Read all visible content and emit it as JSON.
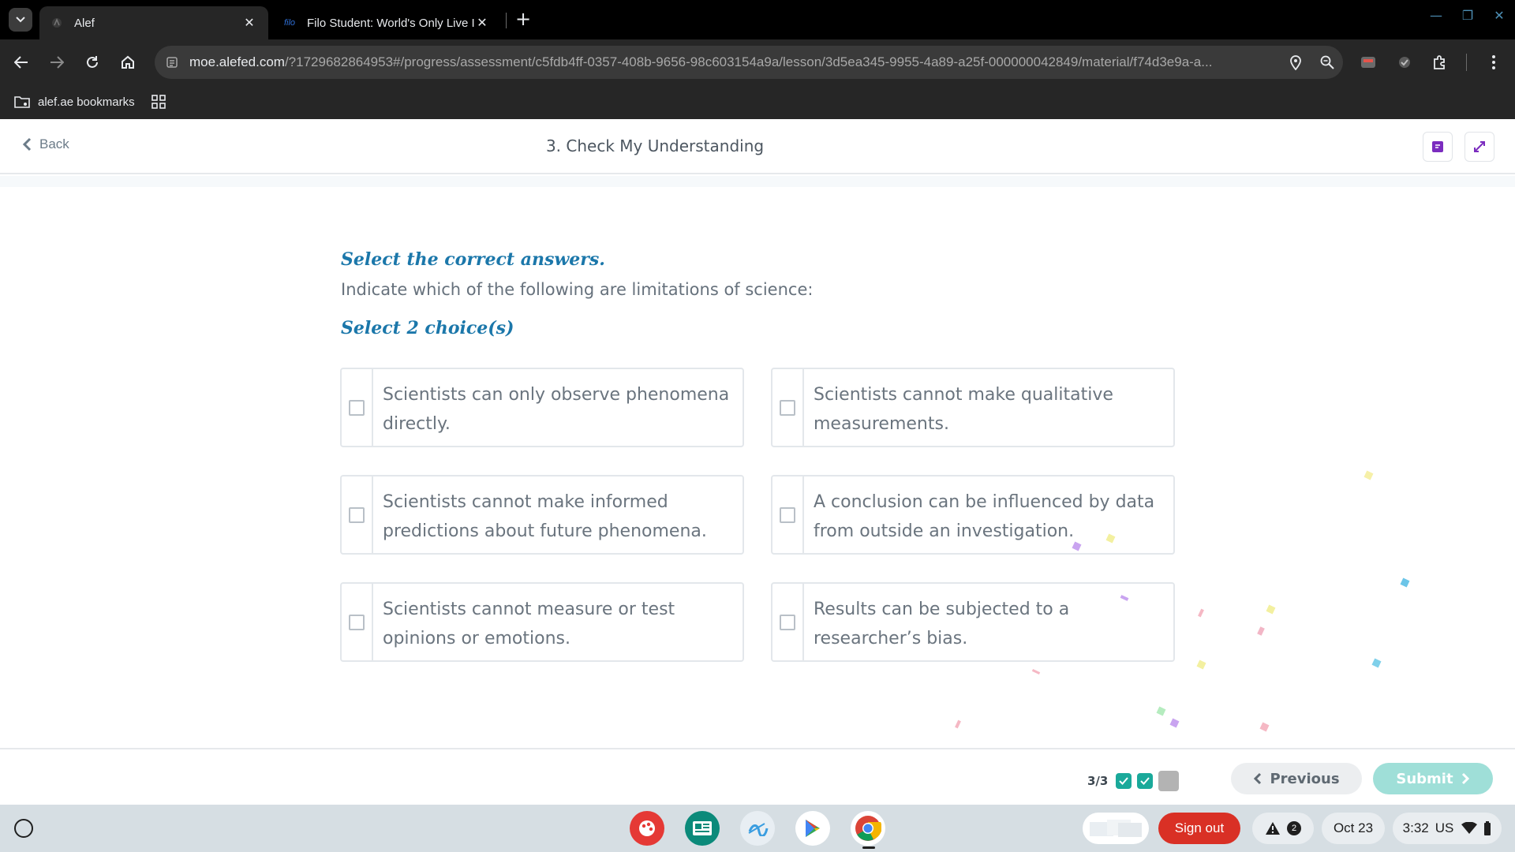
{
  "browser": {
    "tabs": [
      {
        "title": "Alef",
        "favicon": "alef-icon",
        "active": true
      },
      {
        "title": "Filo Student: World's Only Live I",
        "favicon_text": "filo",
        "active": false
      }
    ],
    "url": {
      "host": "moe.alefed.com",
      "path": "/?1729682864953#/progress/assessment/c5fdb4ff-0357-408b-9656-98c603154a9a/lesson/3d5ea345-9955-4a89-a25f-000000042849/material/f74d3e9a-a..."
    },
    "bookmarks": {
      "folder": "alef.ae bookmarks"
    }
  },
  "page": {
    "back_label": "Back",
    "title": "3. Check My Understanding"
  },
  "question": {
    "instruction": "Select the correct answers.",
    "text": "Indicate which of the following are limitations of science:",
    "select_count": "Select 2 choice(s)",
    "options": [
      {
        "text": "Scientists can only observe phenomena directly.",
        "checked": false
      },
      {
        "text": "Scientists cannot make qualitative measurements.",
        "checked": false
      },
      {
        "text": "Scientists cannot make informed predictions about future phenomena.",
        "checked": false
      },
      {
        "text": "A conclusion can be influenced by data from outside an investigation.",
        "checked": false
      },
      {
        "text": "Scientists cannot measure or test opinions or emotions.",
        "checked": false
      },
      {
        "text": "Results can be subjected to a researcher’s bias.",
        "checked": false
      }
    ]
  },
  "footer": {
    "progress_text": "3/3",
    "progress_states": [
      "done",
      "done",
      "todo"
    ],
    "previous_label": "Previous",
    "submit_label": "Submit"
  },
  "shelf": {
    "signout_label": "Sign out",
    "notification_count": "2",
    "date": "Oct 23",
    "time": "3:32",
    "locale": "US"
  },
  "colors": {
    "accent_blue": "#1b77aa",
    "teal_done": "#1aa99a",
    "submit_disabled": "#9fdfd8",
    "signout_red": "#d93025"
  }
}
